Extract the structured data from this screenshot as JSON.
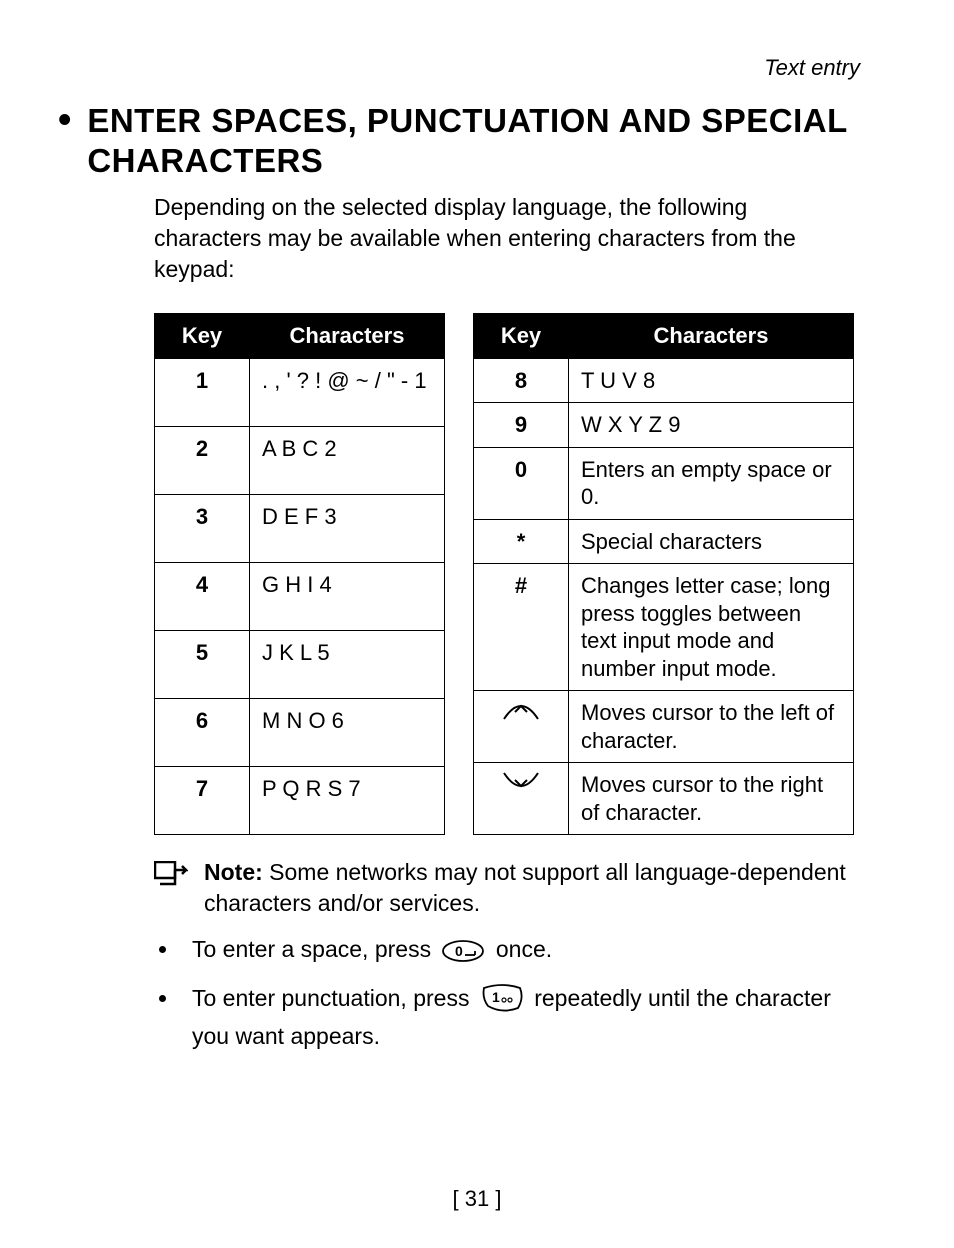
{
  "header": {
    "running": "Text entry"
  },
  "title": "ENTER SPACES, PUNCTUATION AND SPECIAL CHARACTERS",
  "intro": "Depending on the selected display language, the following characters may be available when entering characters from the keypad:",
  "tableHeaders": {
    "key": "Key",
    "chars": "Characters"
  },
  "left": [
    {
      "key": "1",
      "chars": ". , ' ? ! @ ~ / \" - 1"
    },
    {
      "key": "2",
      "chars": "A B C 2"
    },
    {
      "key": "3",
      "chars": "D E F 3"
    },
    {
      "key": "4",
      "chars": "G H I 4"
    },
    {
      "key": "5",
      "chars": "J K L 5"
    },
    {
      "key": "6",
      "chars": "M N O 6"
    },
    {
      "key": "7",
      "chars": "P Q R S 7"
    }
  ],
  "right": [
    {
      "key": "8",
      "chars": "T U V 8"
    },
    {
      "key": "9",
      "chars": "W X Y Z 9"
    },
    {
      "key": "0",
      "chars": "Enters an empty space or 0."
    },
    {
      "key": "*",
      "chars": "Special characters"
    },
    {
      "key": "#",
      "chars": "Changes letter case; long press toggles between text input mode and number input mode."
    },
    {
      "key": "up-arrow",
      "chars": "Moves cursor to the left of character."
    },
    {
      "key": "down-arrow",
      "chars": "Moves cursor to the right of character."
    }
  ],
  "note": {
    "label": "Note:",
    "text": " Some networks may not support all language-dependent characters and/or services."
  },
  "bullets": {
    "b1a": "To enter a space, press ",
    "b1b": " once.",
    "b2a": "To enter punctuation, press ",
    "b2b": " repeatedly until the character you want appears."
  },
  "pageNumber": "[ 31 ]"
}
